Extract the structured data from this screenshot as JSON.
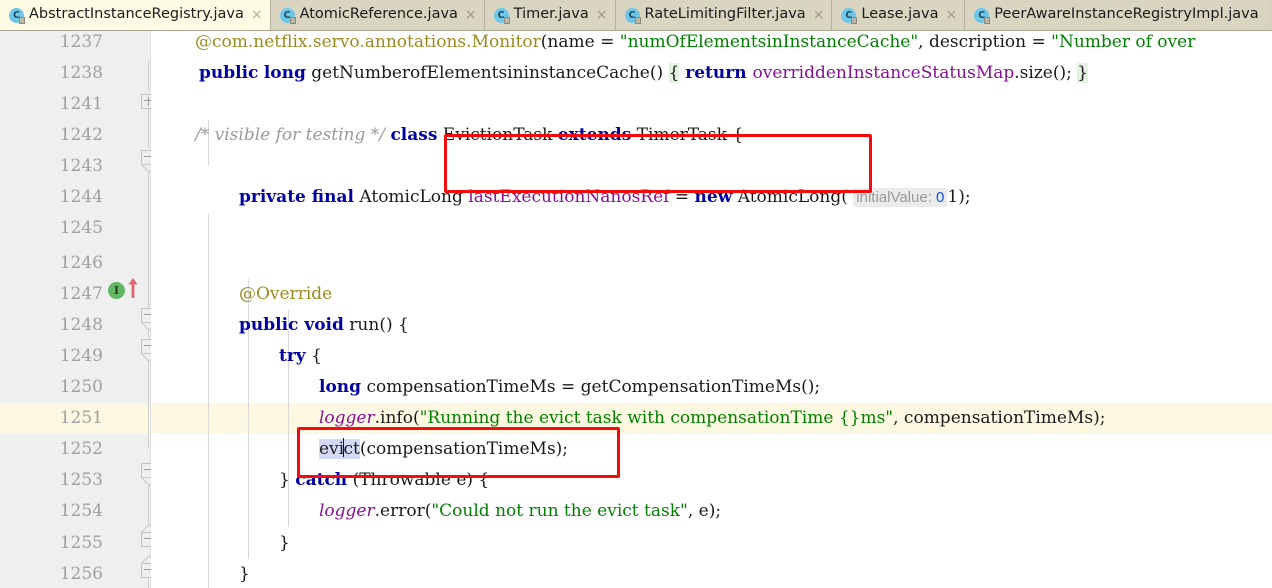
{
  "window": {
    "app": "intellij-idea-editor",
    "accent_red": "#f40b0b",
    "current_line_color": "#fdf8e2"
  },
  "tabs": [
    {
      "label": "AbstractInstanceRegistry.java",
      "icon": "java-class-icon",
      "active": true,
      "close": "×"
    },
    {
      "label": "AtomicReference.java",
      "icon": "java-class-icon",
      "active": false,
      "close": "×"
    },
    {
      "label": "Timer.java",
      "icon": "java-class-icon",
      "active": false,
      "close": "×"
    },
    {
      "label": "RateLimitingFilter.java",
      "icon": "java-class-icon",
      "active": false,
      "close": "×"
    },
    {
      "label": "Lease.java",
      "icon": "java-class-icon",
      "active": false,
      "close": "×"
    },
    {
      "label": "PeerAwareInstanceRegistryImpl.java",
      "icon": "java-class-icon",
      "active": false,
      "close": "×"
    }
  ],
  "tab_icon_letter": "C",
  "editor": {
    "current_line": "1251",
    "line_numbers": [
      "1237",
      "1238",
      "1241",
      "1242",
      "1243",
      "1244",
      "1245",
      "1246",
      "1247",
      "1248",
      "1249",
      "1250",
      "1251",
      "1252",
      "1253",
      "1254",
      "1255",
      "1256"
    ],
    "lines": [
      {
        "num": "1237",
        "text": "@com.netflix.servo.annotations.Monitor(name = \"numOfElementsininstanceCache\", description = \"Number of over"
      },
      {
        "num": "1238",
        "text": "public long getNumberofElementsininstanceCache() { return overriddenInstanceStatusMap.size(); }"
      },
      {
        "num": "1241",
        "text": ""
      },
      {
        "num": "1242",
        "text": "/* visible for testing */ class EvictionTask extends TimerTask {"
      },
      {
        "num": "1243",
        "text": ""
      },
      {
        "num": "1244",
        "text": "private final AtomicLong lastExecutionNanosRef = new AtomicLong( initialValue: 01);"
      },
      {
        "num": "1245",
        "text": ""
      },
      {
        "num": "1246",
        "text": "@Override"
      },
      {
        "num": "1247",
        "text": "public void run() {"
      },
      {
        "num": "1248",
        "text": "try {"
      },
      {
        "num": "1249",
        "text": "long compensationTimeMs = getCompensationTimeMs();"
      },
      {
        "num": "1250",
        "text": "logger.info(\"Running the evict task with compensationTime {}ms\", compensationTimeMs);"
      },
      {
        "num": "1251",
        "text": "evict(compensationTimeMs);"
      },
      {
        "num": "1252",
        "text": "} catch (Throwable e) {"
      },
      {
        "num": "1253",
        "text": "logger.error(\"Could not run the evict task\", e);"
      },
      {
        "num": "1254",
        "text": "}"
      },
      {
        "num": "1255",
        "text": "}"
      },
      {
        "num": "1256",
        "text": ""
      }
    ],
    "tokens": {
      "l1237_at": "@com.netflix.servo.annotations.",
      "l1237_monitor": "Monitor",
      "l1237_paren": "(name = ",
      "l1237_str1": "\"numOfElementsinInstanceCache\"",
      "l1237_mid": ", description = ",
      "l1237_str2": "\"Number of over",
      "l1238_public": "public",
      "l1238_long": "long",
      "l1238_method": " getNumberofElementsininstanceCache() ",
      "l1238_brace1": "{",
      "l1238_return": " return ",
      "l1238_field": "overriddenInstanceStatusMap",
      "l1238_size": ".size(); ",
      "l1238_brace2": "}",
      "l1242_comment": "/* visible for testing */",
      "l1242_class": "class",
      "l1242_name": " EvictionTask ",
      "l1242_extends": "extends",
      "l1242_super": " TimerTask {",
      "l1244_private": "private final",
      "l1244_type": " AtomicLong ",
      "l1244_var": "lastExecutionNanosRef",
      "l1244_eq": " = ",
      "l1244_new": "new",
      "l1244_ctor": " AtomicLong(",
      "l1244_hint": "initialValue:",
      "l1244_zero": "0",
      "l1244_tail": "1);",
      "l1246_override": "@Override",
      "l1247_pub": "public void",
      "l1247_run": " run() {",
      "l1248_try": "try",
      "l1248_brace": " {",
      "l1249_long": "long",
      "l1249_rest": " compensationTimeMs = getCompensationTimeMs();",
      "l1250_logger": "logger",
      "l1250_info": ".info(",
      "l1250_str": "\"Running the evict task with compensationTime {}ms\"",
      "l1250_args": ", compensationTimeMs);",
      "l1251_sel": "evi",
      "l1251_sel2": "ct",
      "l1251_rest": "(compensationTimeMs);",
      "l1252_close": "} ",
      "l1252_catch": "catch",
      "l1252_rest": " (Throwable e) {",
      "l1253_logger": "logger",
      "l1253_error": ".error(",
      "l1253_str": "\"Could not run the evict task\"",
      "l1253_args": ", e);",
      "l1254_brace": "}",
      "l1255_brace": "}"
    },
    "gutter_icons": {
      "implements_letter": "I",
      "implements_tooltip_line": "1247"
    },
    "annotations": [
      {
        "name": "eviction-task-class-highlight",
        "target": "class EvictionTask extends TimerTask {"
      },
      {
        "name": "evict-call-highlight",
        "target": "evict(compensationTimeMs);"
      }
    ]
  }
}
